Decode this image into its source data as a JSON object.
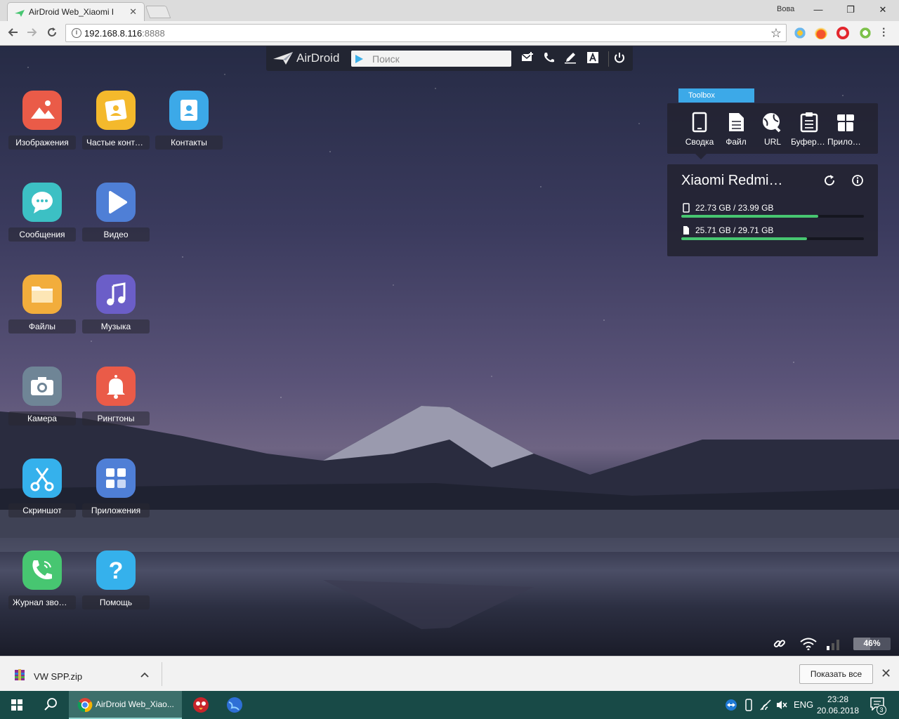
{
  "browser": {
    "tab_title": "AirDroid Web_Xiaomi Redmi",
    "tab_close": "✕",
    "user": "Вова",
    "address_host": "192.168.8.116",
    "address_port": ":8888",
    "min": "—",
    "max": "❐",
    "close": "✕"
  },
  "airdroid": {
    "brand": "AirDroid",
    "search_placeholder": "Поиск"
  },
  "apps": [
    {
      "label": "Изображения",
      "color": "#ea5b48"
    },
    {
      "label": "Частые контакты",
      "color": "#f4b92c"
    },
    {
      "label": "Контакты",
      "color": "#3ca9e8"
    },
    {
      "label": "Сообщения",
      "color": "#3cc0c4"
    },
    {
      "label": "Видео",
      "color": "#4f7fd6"
    },
    {
      "label": "Файлы",
      "color": "#f2ad3c"
    },
    {
      "label": "Музыка",
      "color": "#6b5ec8"
    },
    {
      "label": "Камера",
      "color": "#6f8596"
    },
    {
      "label": "Рингтоны",
      "color": "#ea5b48"
    },
    {
      "label": "Скриншот",
      "color": "#35b1ec"
    },
    {
      "label": "Приложения",
      "color": "#4f7fd6"
    },
    {
      "label": "Журнал звонков",
      "color": "#47c671"
    },
    {
      "label": "Помощь",
      "color": "#35b1ec"
    }
  ],
  "toolbox": {
    "title": "Toolbox",
    "items": [
      {
        "label": "Сводка"
      },
      {
        "label": "Файл"
      },
      {
        "label": "URL"
      },
      {
        "label": "Буфер обмена"
      },
      {
        "label": "Приложения"
      }
    ]
  },
  "device": {
    "name": "Xiaomi Redmi Note",
    "storage": [
      {
        "text": "22.73 GB / 23.99 GB",
        "fraction": 0.75
      },
      {
        "text": "25.71 GB / 29.71 GB",
        "fraction": 0.69
      }
    ]
  },
  "status": {
    "battery_text": "46%",
    "battery_level": 0.46
  },
  "download": {
    "file": "VW SPP.zip",
    "show_all": "Показать все"
  },
  "taskbar": {
    "chrome_label": "AirDroid Web_Xiao...",
    "lang": "ENG",
    "time": "23:28",
    "date": "20.06.2018",
    "notifications": "3"
  },
  "colors": {
    "accent": "#3ca9e8",
    "progress": "#47c671"
  }
}
